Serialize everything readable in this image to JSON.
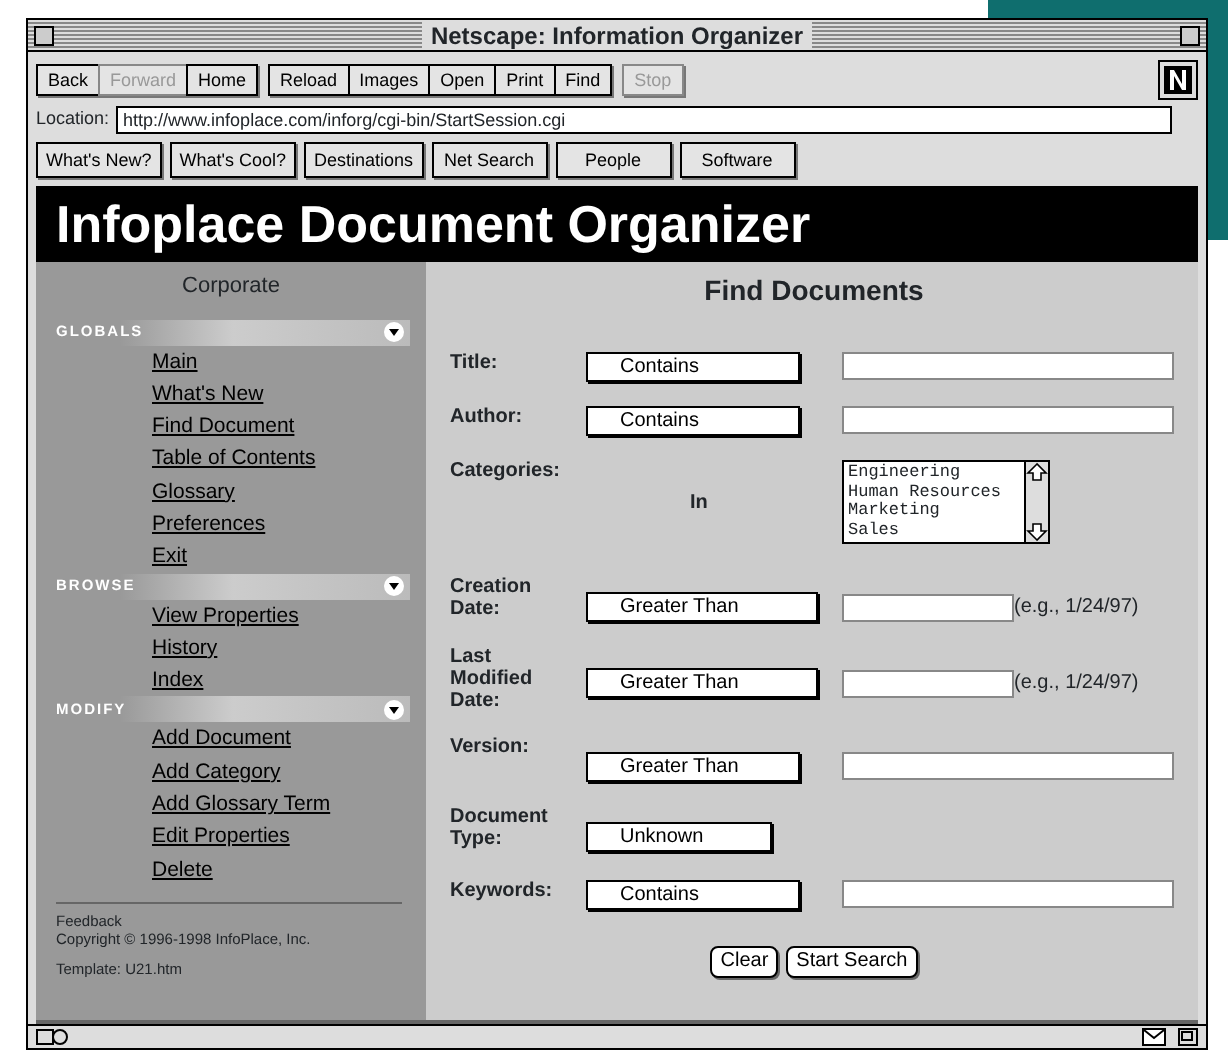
{
  "window": {
    "title": "Netscape: Information Organizer"
  },
  "toolbar": {
    "groups": [
      [
        {
          "label": "Back",
          "disabled": false
        },
        {
          "label": "Forward",
          "disabled": true
        },
        {
          "label": "Home",
          "disabled": false
        }
      ],
      [
        {
          "label": "Reload",
          "disabled": false
        },
        {
          "label": "Images",
          "disabled": false
        },
        {
          "label": "Open",
          "disabled": false
        },
        {
          "label": "Print",
          "disabled": false
        },
        {
          "label": "Find",
          "disabled": false
        }
      ],
      [
        {
          "label": "Stop",
          "disabled": true
        }
      ]
    ]
  },
  "location": {
    "label": "Location:",
    "value": "http://www.infoplace.com/inforg/cgi-bin/StartSession.cgi"
  },
  "directory_buttons": [
    "What's New?",
    "What's Cool?",
    "Destinations",
    "Net Search",
    "People",
    "Software"
  ],
  "banner": {
    "title": "Infoplace Document Organizer"
  },
  "sidebar": {
    "title": "Corporate",
    "sections": [
      {
        "heading": "GLOBALS",
        "items": [
          "Main",
          "What's New",
          "Find Document",
          "Table of Contents",
          "Glossary",
          "Preferences",
          "Exit"
        ]
      },
      {
        "heading": "BROWSE",
        "items": [
          "View Properties",
          "History",
          "Index"
        ]
      },
      {
        "heading": "MODIFY",
        "items": [
          "Add Document",
          "Add Category",
          "Add Glossary Term",
          "Edit Properties",
          "Delete"
        ]
      }
    ],
    "feedback": "Feedback",
    "copyright": "Copyright © 1996-1998  InfoPlace, Inc.",
    "template": "Template: U21.htm"
  },
  "form": {
    "title": "Find Documents",
    "rows": [
      {
        "kind": "text",
        "label": "Title:",
        "operator": "Contains"
      },
      {
        "kind": "text",
        "label": "Author:",
        "operator": "Contains"
      },
      {
        "kind": "list",
        "label": "Categories:",
        "operator": "In",
        "options": [
          "Engineering",
          "Human Resources",
          "Marketing",
          "Sales"
        ]
      },
      {
        "kind": "date",
        "label": "Creation Date:",
        "operator": "Greater Than",
        "hint": "(e.g., 1/24/97)"
      },
      {
        "kind": "date",
        "label": "Last Modified Date:",
        "operator": "Greater Than",
        "hint": "(e.g., 1/24/97)"
      },
      {
        "kind": "text",
        "label": "Version:",
        "operator": "Greater Than"
      },
      {
        "kind": "choice",
        "label": "Document Type:",
        "operator": "Unknown"
      },
      {
        "kind": "text",
        "label": "Keywords:",
        "operator": "Contains"
      }
    ],
    "buttons": [
      "Clear",
      "Start Search"
    ]
  }
}
